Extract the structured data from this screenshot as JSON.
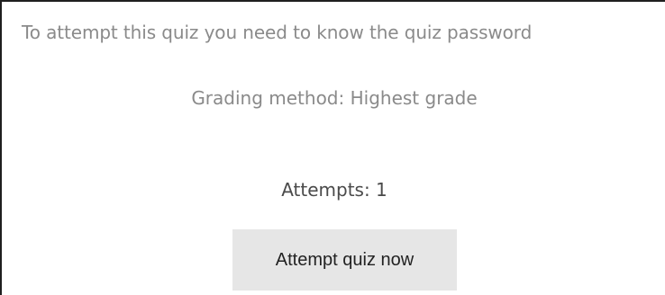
{
  "quiz": {
    "password_notice": "To attempt this quiz you need to know the quiz password",
    "grading_method": "Grading method: Highest grade",
    "attempts": "Attempts: 1",
    "attempt_button_label": "Attempt quiz now"
  }
}
